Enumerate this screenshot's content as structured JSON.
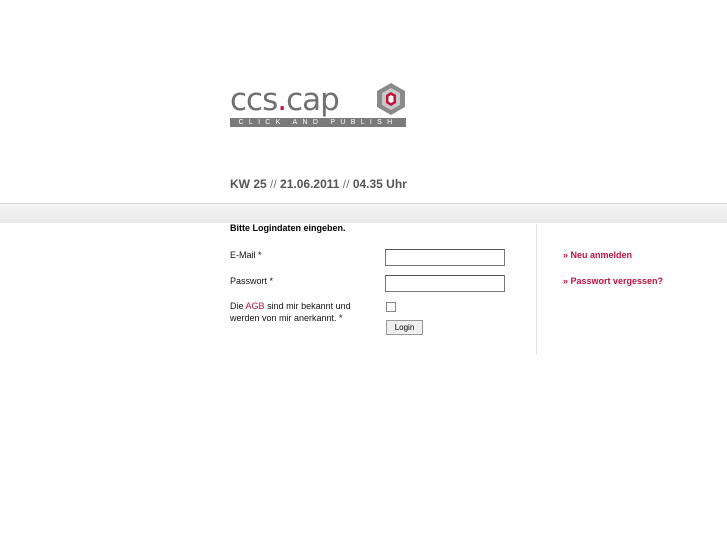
{
  "logo": {
    "name": "ccs",
    "dot": ".",
    "suffix": "cap",
    "tagline": "CLICK AND PUBLISH"
  },
  "date": {
    "week": "KW 25",
    "sep1": "//",
    "day": "21.06.2011",
    "sep2": "//",
    "time": "04.35 Uhr"
  },
  "form": {
    "title": "Bitte Logindaten eingeben.",
    "email_label": "E-Mail *",
    "email_value": "",
    "password_label": "Passwort *",
    "password_value": "",
    "agb_prefix": "Die",
    "agb_link": "AGB",
    "agb_suffix": "sind mir bekannt und werden von mir anerkannt. *",
    "agb_checked": false,
    "login_label": "Login"
  },
  "side": {
    "register": "» Neu anmelden",
    "forgot": "» Passwort vergessen?"
  },
  "colors": {
    "accent": "#c0133e",
    "logo_gray": "#707070"
  }
}
